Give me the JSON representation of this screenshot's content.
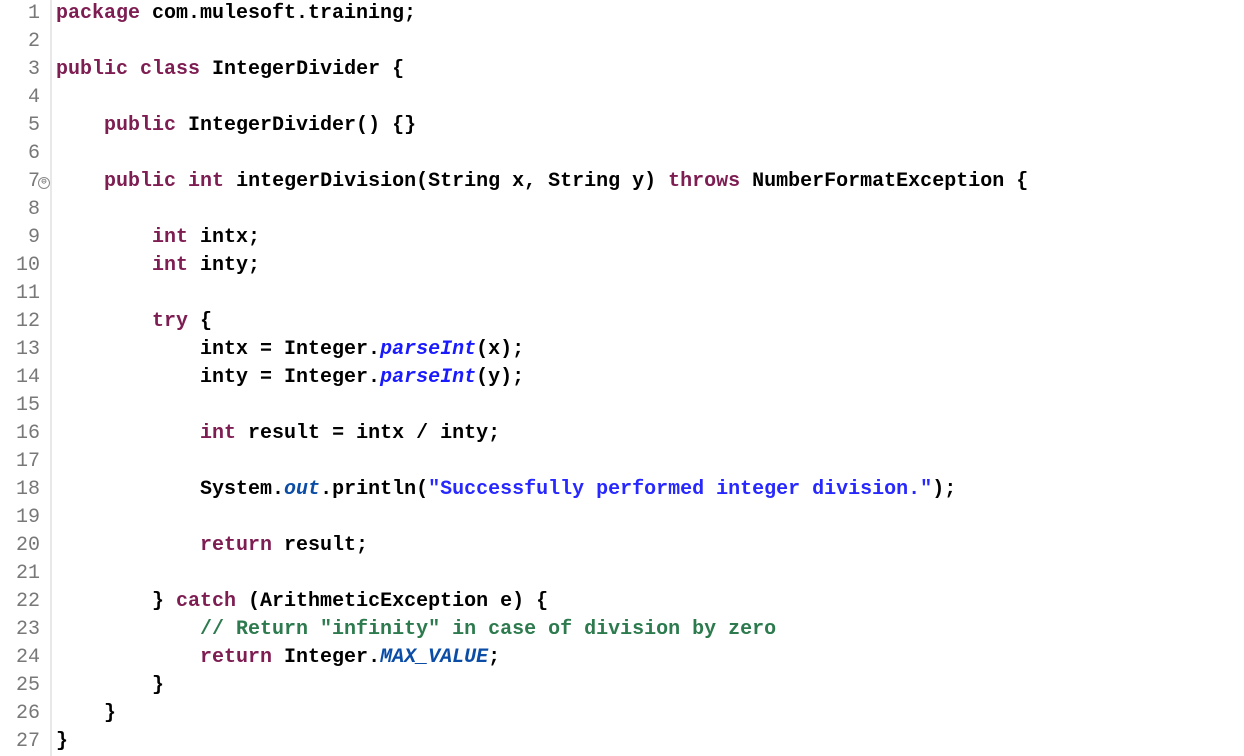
{
  "lines": [
    {
      "num": "1",
      "tokens": [
        [
          "kw",
          "package"
        ],
        [
          "plain",
          " com.mulesoft.training;"
        ]
      ]
    },
    {
      "num": "2",
      "tokens": []
    },
    {
      "num": "3",
      "tokens": [
        [
          "kw",
          "public"
        ],
        [
          "plain",
          " "
        ],
        [
          "kw",
          "class"
        ],
        [
          "plain",
          " IntegerDivider {"
        ]
      ]
    },
    {
      "num": "4",
      "tokens": []
    },
    {
      "num": "5",
      "tokens": [
        [
          "plain",
          "    "
        ],
        [
          "kw",
          "public"
        ],
        [
          "plain",
          " IntegerDivider() {}"
        ]
      ]
    },
    {
      "num": "6",
      "tokens": []
    },
    {
      "num": "7",
      "fold": true,
      "tokens": [
        [
          "plain",
          "    "
        ],
        [
          "kw",
          "public"
        ],
        [
          "plain",
          " "
        ],
        [
          "kw",
          "int"
        ],
        [
          "plain",
          " integerDivision(String x, String y) "
        ],
        [
          "kw",
          "throws"
        ],
        [
          "plain",
          " NumberFormatException {"
        ]
      ]
    },
    {
      "num": "8",
      "tokens": []
    },
    {
      "num": "9",
      "tokens": [
        [
          "plain",
          "        "
        ],
        [
          "kw",
          "int"
        ],
        [
          "plain",
          " intx;"
        ]
      ]
    },
    {
      "num": "10",
      "tokens": [
        [
          "plain",
          "        "
        ],
        [
          "kw",
          "int"
        ],
        [
          "plain",
          " inty;"
        ]
      ]
    },
    {
      "num": "11",
      "tokens": []
    },
    {
      "num": "12",
      "tokens": [
        [
          "plain",
          "        "
        ],
        [
          "kw",
          "try"
        ],
        [
          "plain",
          " {"
        ]
      ]
    },
    {
      "num": "13",
      "tokens": [
        [
          "plain",
          "            intx = Integer."
        ],
        [
          "static-ital",
          "parseInt"
        ],
        [
          "plain",
          "(x);"
        ]
      ]
    },
    {
      "num": "14",
      "tokens": [
        [
          "plain",
          "            inty = Integer."
        ],
        [
          "static-ital",
          "parseInt"
        ],
        [
          "plain",
          "(y);"
        ]
      ]
    },
    {
      "num": "15",
      "tokens": []
    },
    {
      "num": "16",
      "tokens": [
        [
          "plain",
          "            "
        ],
        [
          "kw",
          "int"
        ],
        [
          "plain",
          " result = intx / inty;"
        ]
      ]
    },
    {
      "num": "17",
      "tokens": []
    },
    {
      "num": "18",
      "tokens": [
        [
          "plain",
          "            System."
        ],
        [
          "const-ital",
          "out"
        ],
        [
          "plain",
          ".println("
        ],
        [
          "string",
          "\"Successfully performed integer division.\""
        ],
        [
          "plain",
          ");"
        ]
      ]
    },
    {
      "num": "19",
      "tokens": []
    },
    {
      "num": "20",
      "tokens": [
        [
          "plain",
          "            "
        ],
        [
          "kw",
          "return"
        ],
        [
          "plain",
          " result;"
        ]
      ]
    },
    {
      "num": "21",
      "tokens": []
    },
    {
      "num": "22",
      "tokens": [
        [
          "plain",
          "        } "
        ],
        [
          "kw",
          "catch"
        ],
        [
          "plain",
          " (ArithmeticException e) {"
        ]
      ]
    },
    {
      "num": "23",
      "tokens": [
        [
          "plain",
          "            "
        ],
        [
          "comment",
          "// Return \"infinity\" in case of division by zero"
        ]
      ]
    },
    {
      "num": "24",
      "tokens": [
        [
          "plain",
          "            "
        ],
        [
          "kw",
          "return"
        ],
        [
          "plain",
          " Integer."
        ],
        [
          "const-ital",
          "MAX_VALUE"
        ],
        [
          "plain",
          ";"
        ]
      ]
    },
    {
      "num": "25",
      "tokens": [
        [
          "plain",
          "        }"
        ]
      ]
    },
    {
      "num": "26",
      "tokens": [
        [
          "plain",
          "    }"
        ]
      ]
    },
    {
      "num": "27",
      "tokens": [
        [
          "plain",
          "}"
        ]
      ]
    }
  ],
  "fold_glyph": "⊖"
}
